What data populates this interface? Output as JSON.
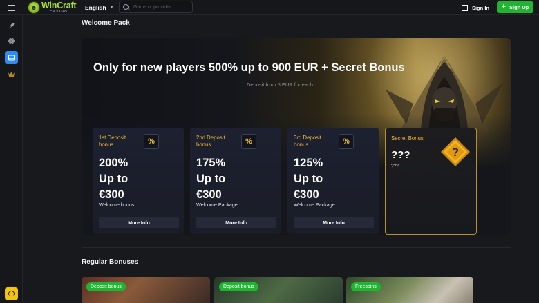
{
  "header": {
    "logo_main": "WinCraft",
    "logo_sub": "CASINO",
    "language": "English",
    "search_placeholder": "Game or provider",
    "sign_in": "Sign In",
    "sign_up": "Sign Up"
  },
  "sidebar": {
    "items": [
      {
        "icon": "rocket-icon"
      },
      {
        "icon": "atom-icon"
      },
      {
        "icon": "promotions-icon",
        "active": true
      },
      {
        "icon": "crown-icon"
      }
    ],
    "support_icon": "headset-icon"
  },
  "welcome": {
    "section_title": "Welcome Pack",
    "hero_title": "Only for new players 500% up to 900 EUR + Secret Bonus",
    "hero_subtitle": "Deposit from 5 EUR for each",
    "cards": [
      {
        "label": "1st Deposit bonus",
        "badge": "%",
        "percent": "200%",
        "upto": "Up to",
        "amount": "€300",
        "desc": "Welcome bonus",
        "button": "More Info"
      },
      {
        "label": "2nd Deposit bonus",
        "badge": "%",
        "percent": "175%",
        "upto": "Up to",
        "amount": "€300",
        "desc": "Welcome Package",
        "button": "More Info"
      },
      {
        "label": "3rd Deposit bonus",
        "badge": "%",
        "percent": "125%",
        "upto": "Up to",
        "amount": "€300",
        "desc": "Welcome Package",
        "button": "More Info"
      }
    ],
    "secret": {
      "label": "Secret Bonus",
      "title": "???",
      "subtitle": "???"
    }
  },
  "regular": {
    "section_title": "Regular Bonuses",
    "promos": [
      {
        "tag": "Deposit bonus"
      },
      {
        "tag": "Deposit bonus"
      },
      {
        "tag": "Freespins"
      }
    ]
  },
  "colors": {
    "accent_green": "#21b432",
    "accent_gold": "#f0b93a",
    "active_blue": "#2c8ef5",
    "support_yellow": "#f2c40f"
  }
}
